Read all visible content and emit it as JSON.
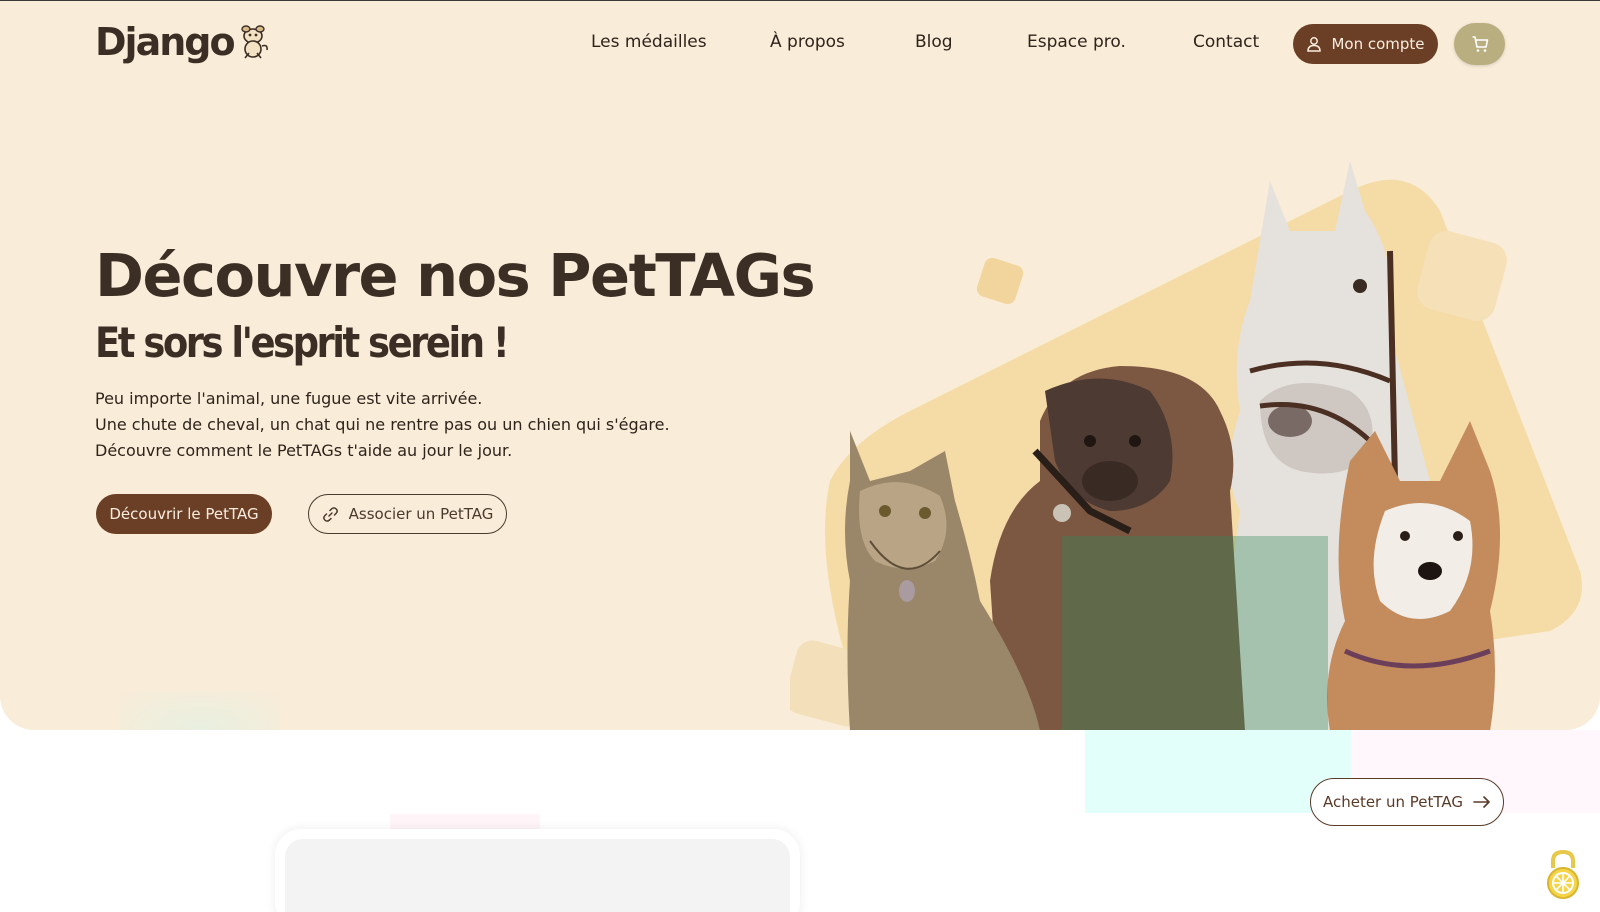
{
  "brand": {
    "name": "Django"
  },
  "nav": {
    "items": [
      {
        "label": "Les médailles"
      },
      {
        "label": "À propos"
      },
      {
        "label": "Blog"
      },
      {
        "label": "Espace pro."
      },
      {
        "label": "Contact"
      }
    ],
    "account_label": "Mon compte",
    "account_icon": "user-icon",
    "cart_icon": "cart-icon"
  },
  "hero": {
    "title": "Découvre nos PetTAGs",
    "subtitle": "Et sors l'esprit serein !",
    "lines": [
      "Peu importe l'animal, une fugue est vite arrivée.",
      "Une chute de cheval, un chat qui ne rentre pas ou un chien qui s'égare.",
      "Découvre comment le PetTAGs t'aide au jour le jour."
    ],
    "primary_button": "Découvrir le PetTAG",
    "secondary_button": "Associer un PetTAG",
    "secondary_icon": "link-icon"
  },
  "buy": {
    "label": "Acheter un PetTAG",
    "icon": "arrow-right-icon"
  },
  "colors": {
    "hero_bg": "#f9ecd8",
    "brand_brown": "#6b3f25",
    "cart_bg": "#b9ae80",
    "accent_yellow": "#f4d9a0"
  }
}
